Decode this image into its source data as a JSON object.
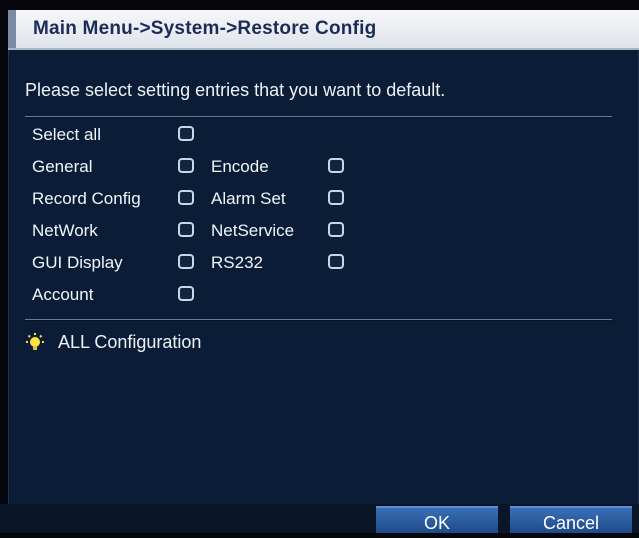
{
  "title": "Main Menu->System->Restore Config",
  "instruction": "Please select setting entries that you want to default.",
  "entries": {
    "select_all": "Select all",
    "general": "General",
    "encode": "Encode",
    "record_config": "Record Config",
    "alarm_set": "Alarm Set",
    "network": "NetWork",
    "netservice": "NetService",
    "gui_display": "GUI Display",
    "rs232": "RS232",
    "account": "Account"
  },
  "status": {
    "icon": "lightbulb-icon",
    "text": "ALL Configuration"
  },
  "buttons": {
    "ok": "OK",
    "cancel": "Cancel"
  },
  "colors": {
    "panel": "#0b1d36",
    "title_bg": "#e9ecf1",
    "title_text": "#1a2c58",
    "button": "#2a5a9e"
  }
}
